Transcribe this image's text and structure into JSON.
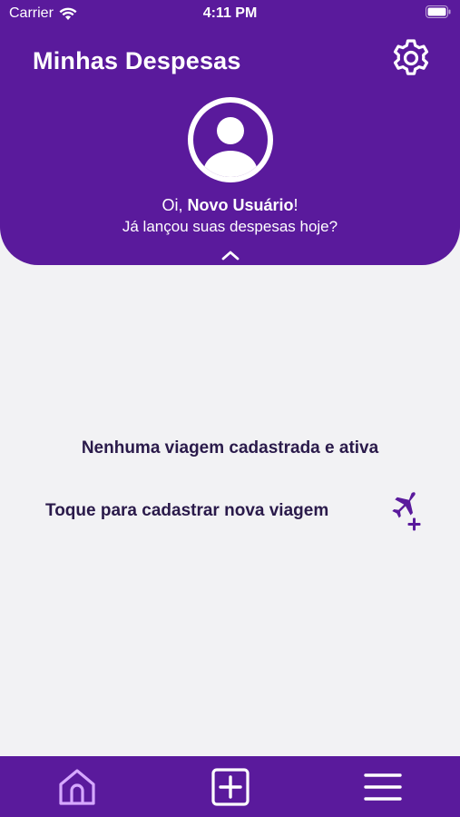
{
  "status_bar": {
    "carrier": "Carrier",
    "time": "4:11 PM"
  },
  "header": {
    "title": "Minhas Despesas",
    "greeting_prefix": "Oi, ",
    "user_name": "Novo Usuário",
    "greeting_suffix": "!",
    "subtitle": "Já lançou suas despesas hoje?"
  },
  "main": {
    "empty_message": "Nenhuma viagem cadastrada e ativa",
    "add_trip_label": "Toque para cadastrar nova viagem"
  },
  "tabbar": {
    "items": [
      {
        "icon": "home-icon",
        "active": true
      },
      {
        "icon": "add-square-icon",
        "active": false
      },
      {
        "icon": "menu-icon",
        "active": false
      }
    ]
  },
  "colors": {
    "primary": "#5a1a9c",
    "background": "#f2f2f4",
    "text_dark": "#2a1a4a",
    "active_tab": "#d6a8ff"
  }
}
